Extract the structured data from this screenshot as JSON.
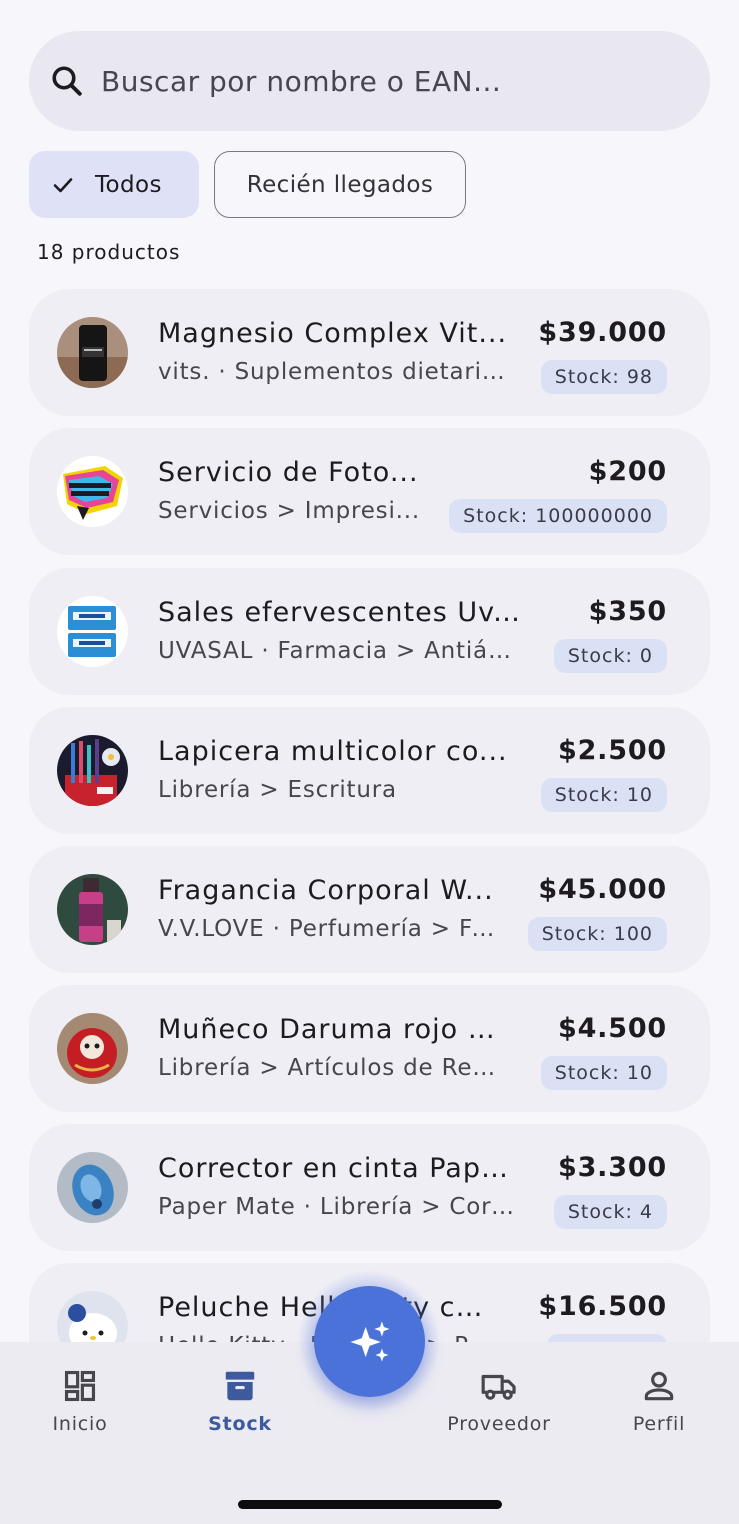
{
  "search": {
    "placeholder": "Buscar por nombre o EAN..."
  },
  "filters": [
    {
      "label": "Todos",
      "selected": true
    },
    {
      "label": "Recién llegados",
      "selected": false
    }
  ],
  "product_count": "18 productos",
  "products": [
    {
      "name": "Magnesio Complex Vit...",
      "subtitle": "vits. · Suplementos dietario...",
      "price": "$39.000",
      "stock": "Stock: 98"
    },
    {
      "name": "Servicio de Foto...",
      "subtitle": "Servicios > Impresi...",
      "price": "$200",
      "stock": "Stock: 100000000"
    },
    {
      "name": "Sales efervescentes Uv...",
      "subtitle": "UVASAL · Farmacia > Antiác...",
      "price": "$350",
      "stock": "Stock: 0"
    },
    {
      "name": "Lapicera multicolor co...",
      "subtitle": "Librería > Escritura",
      "price": "$2.500",
      "stock": "Stock: 10"
    },
    {
      "name": "Fragancia Corporal W...",
      "subtitle": "V.V.LOVE · Perfumería > Fr...",
      "price": "$45.000",
      "stock": "Stock: 100"
    },
    {
      "name": "Muñeco Daruma rojo d...",
      "subtitle": "Librería > Artículos de Reg...",
      "price": "$4.500",
      "stock": "Stock: 10"
    },
    {
      "name": "Corrector en cinta Pape...",
      "subtitle": "Paper Mate · Librería > Corr...",
      "price": "$3.300",
      "stock": "Stock: 4"
    },
    {
      "name": "Peluche Hello Kitty co...",
      "subtitle": "Hello Kitty · Peluches > Pel...",
      "price": "$16.500",
      "stock": ""
    }
  ],
  "nav": {
    "items": [
      {
        "label": "Inicio",
        "icon": "dashboard-icon",
        "active": false
      },
      {
        "label": "Stock",
        "icon": "archive-icon",
        "active": true
      },
      {
        "label": "Proveedor",
        "icon": "truck-icon",
        "active": false
      },
      {
        "label": "Perfil",
        "icon": "person-icon",
        "active": false
      }
    ],
    "fab_icon": "sparkles-icon"
  },
  "colors": {
    "accent": "#4a72d9",
    "active_nav": "#3d5a9c",
    "chip_selected": "#dfe2f6",
    "stock_badge": "#dbe1f5"
  }
}
